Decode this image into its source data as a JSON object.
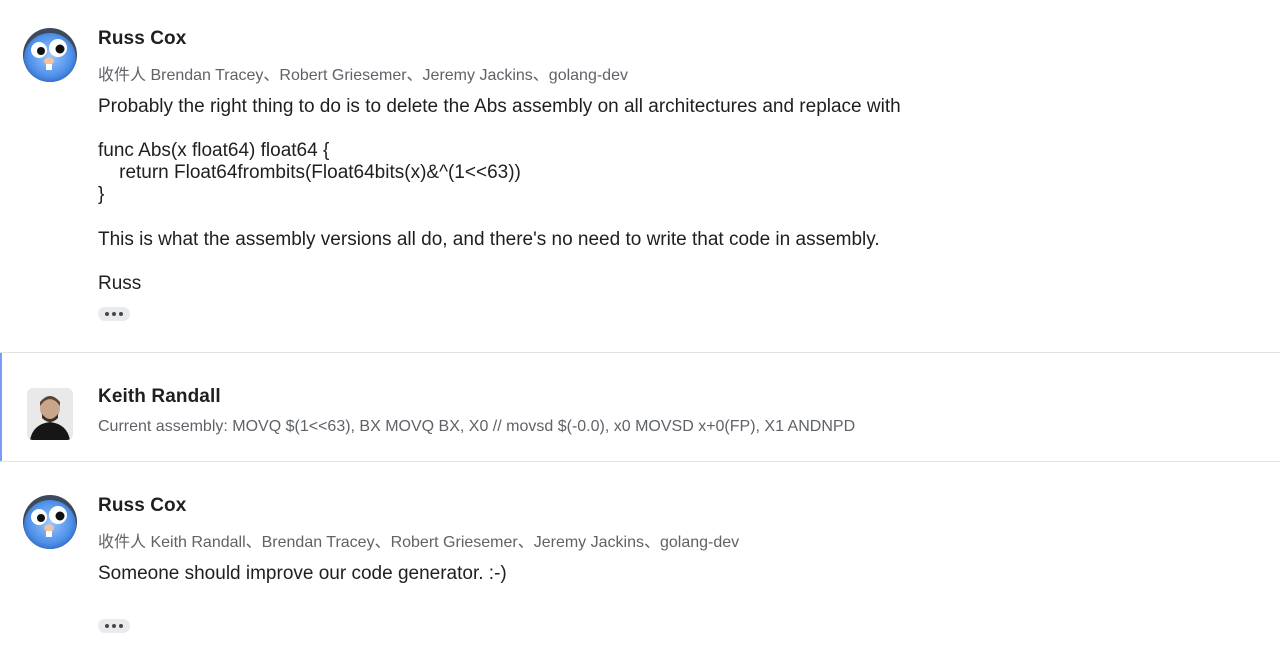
{
  "messages": [
    {
      "sender": "Russ Cox",
      "recipients": "收件人 Brendan Tracey、Robert Griesemer、Jeremy Jackins、golang-dev",
      "body": {
        "line1": "Probably the right thing to do is to delete the Abs assembly on all architectures and replace with",
        "code1": "func Abs(x float64) float64 {",
        "code2": "    return Float64frombits(Float64bits(x)&^(1<<63))",
        "code3": "}",
        "line2": "This is what the assembly versions all do, and there's no need to write that code in assembly.",
        "signature": "Russ"
      },
      "avatar_icon": "gopher-avatar-icon"
    },
    {
      "sender": "Keith Randall",
      "snippet": "Current assembly: MOVQ $(1<<63), BX MOVQ BX, X0 // movsd $(-0.0), x0 MOVSD x+0(FP), X1 ANDNPD",
      "avatar_icon": "person-photo-avatar",
      "accent_color": "#7a9cf5"
    },
    {
      "sender": "Russ Cox",
      "recipients": "收件人 Keith Randall、Brendan Tracey、Robert Griesemer、Jeremy Jackins、golang-dev",
      "body": {
        "line1": "Someone should improve our code generator. :-)"
      },
      "avatar_icon": "gopher-avatar-icon"
    }
  ]
}
